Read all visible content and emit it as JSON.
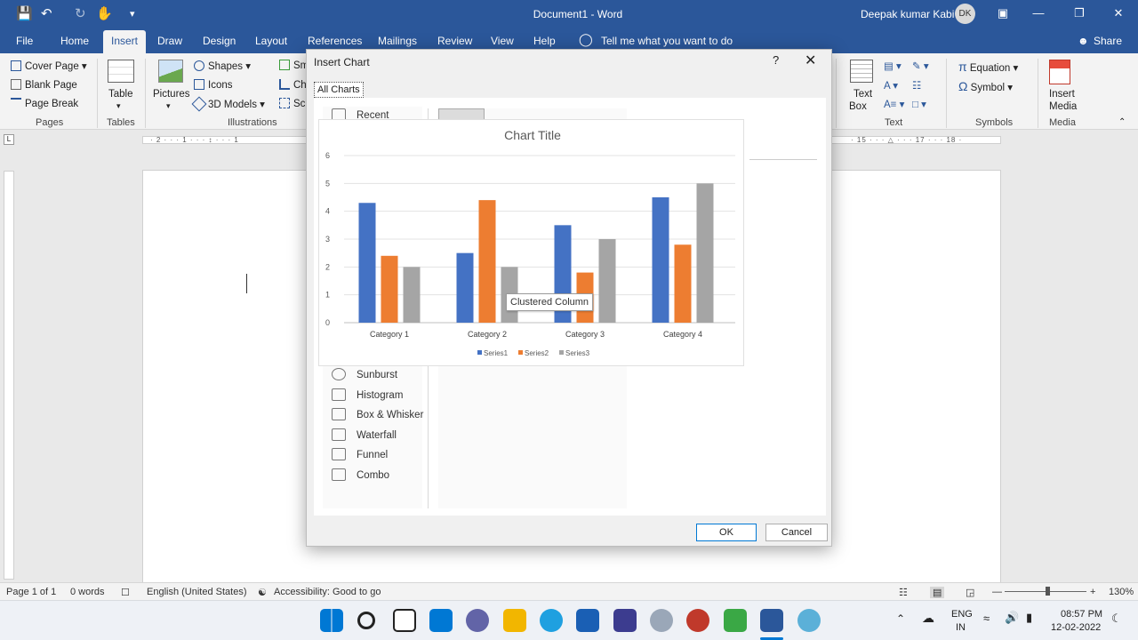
{
  "window": {
    "title": "Document1 - Word",
    "user_name": "Deepak kumar Kabi",
    "user_initials": "DK"
  },
  "tabs": [
    "File",
    "Home",
    "Insert",
    "Draw",
    "Design",
    "Layout",
    "References",
    "Mailings",
    "Review",
    "View",
    "Help"
  ],
  "tell_me": "Tell me what you want to do",
  "share": "Share",
  "ribbon": {
    "pages": {
      "cover_page": "Cover Page",
      "blank_page": "Blank Page",
      "page_break": "Page Break",
      "group": "Pages"
    },
    "tables": {
      "table": "Table",
      "group": "Tables"
    },
    "illustrations": {
      "pictures": "Pictures",
      "shapes": "Shapes",
      "icons": "Icons",
      "models": "3D Models",
      "smartart": "Sm",
      "chart": "Ch",
      "screenshot": "Scr",
      "group": "Illustrations"
    },
    "text": {
      "text_box_1": "Text",
      "text_box_2": "Box",
      "group": "Text"
    },
    "symbols": {
      "equation": "Equation",
      "symbol": "Symbol",
      "group": "Symbols"
    },
    "media": {
      "insert_1": "Insert",
      "insert_2": "Media",
      "group": "Media"
    }
  },
  "ruler_text": "· 2 · · · 1 · · · ↕ · · · 1",
  "ruler_text_right": "· 15 · · · △ · · · 17 · · · 18 ·",
  "status": {
    "page": "Page 1 of 1",
    "words": "0 words",
    "language": "English (United States)",
    "accessibility": "Accessibility: Good to go",
    "zoom": "130%"
  },
  "taskbar": {
    "lang_1": "ENG",
    "lang_2": "IN",
    "time": "08:57 PM",
    "date": "12-02-2022"
  },
  "dialog": {
    "title": "Insert Chart",
    "help": "?",
    "tab": "All Charts",
    "recent": "Recent",
    "chart_types": [
      "Sunburst",
      "Histogram",
      "Box & Whisker",
      "Waterfall",
      "Funnel",
      "Combo"
    ],
    "ok": "OK",
    "cancel": "Cancel",
    "tooltip": "Clustered Column"
  },
  "chart_data": {
    "type": "bar",
    "title": "Chart Title",
    "categories": [
      "Category 1",
      "Category 2",
      "Category 3",
      "Category 4"
    ],
    "series": [
      {
        "name": "Series1",
        "values": [
          4.3,
          2.5,
          3.5,
          4.5
        ],
        "color": "#4472c4"
      },
      {
        "name": "Series2",
        "values": [
          2.4,
          4.4,
          1.8,
          2.8
        ],
        "color": "#ed7d31"
      },
      {
        "name": "Series3",
        "values": [
          2,
          2,
          3,
          5
        ],
        "color": "#a5a5a5"
      }
    ],
    "ylim": [
      0,
      6
    ],
    "yticks": [
      0,
      1,
      2,
      3,
      4,
      5,
      6
    ],
    "grid": true,
    "legend": "bottom"
  }
}
